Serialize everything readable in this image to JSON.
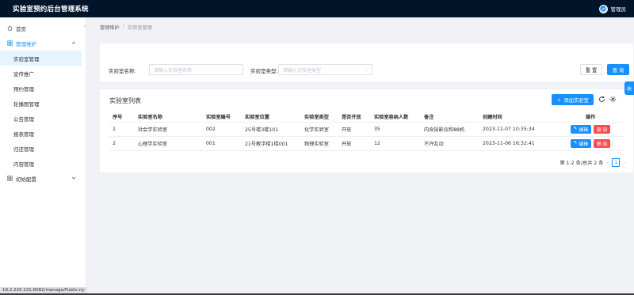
{
  "app": {
    "title": "实验室预约后台管理系统",
    "user_name": "管理员"
  },
  "sidebar": {
    "items": [
      {
        "label": "首页",
        "icon": "home-icon"
      },
      {
        "label": "管理维护",
        "icon": "grid-icon"
      },
      {
        "label": "初始配置",
        "icon": "grid-icon"
      }
    ],
    "sub_items": [
      {
        "label": "实验室管理"
      },
      {
        "label": "宣传推广"
      },
      {
        "label": "预约管理"
      },
      {
        "label": "轮播图管理"
      },
      {
        "label": "公告管理"
      },
      {
        "label": "报表管理"
      },
      {
        "label": "归还管理"
      },
      {
        "label": "内容管理"
      }
    ]
  },
  "status_url": "19.2.220.131:8082/manage/Public.ny",
  "breadcrumb": {
    "parent": "管理维护",
    "separator": "/",
    "current": "实验室管理"
  },
  "search": {
    "name_label": "实验室名称:",
    "name_placeholder": "请输入实验室名称",
    "type_label": "实验室类型:",
    "type_placeholder": "请输入实验室类型",
    "reset_label": "重 置",
    "query_label": "查 询"
  },
  "table": {
    "title": "实验室列表",
    "add_label": "添加实验室",
    "columns": [
      "序号",
      "实验室名称",
      "实验室编号",
      "实验室位置",
      "实验室类型",
      "是否开放",
      "实验室容纳人数",
      "备注",
      "创建时间",
      "操作"
    ],
    "rows": [
      [
        "1",
        "社会学实验室",
        "002",
        "25号楼3楼101",
        "化学实验室",
        "开放",
        "35",
        "内含投影仪和88机",
        "2023-11-07 10:35:34"
      ],
      [
        "2",
        "心理学实验室",
        "001",
        "21号教学楼1楼001",
        "物理实验室",
        "开放",
        "12",
        "不许乱动",
        "2023-11-06 16:32:41"
      ]
    ],
    "edit_label": "编辑",
    "delete_label": "删 除"
  },
  "pagination": {
    "summary": "第 1-2 条/总共 2 条",
    "current_page": "1"
  },
  "colors": {
    "primary": "#1890ff",
    "danger": "#ff4d4f",
    "topbar": "#001529"
  }
}
